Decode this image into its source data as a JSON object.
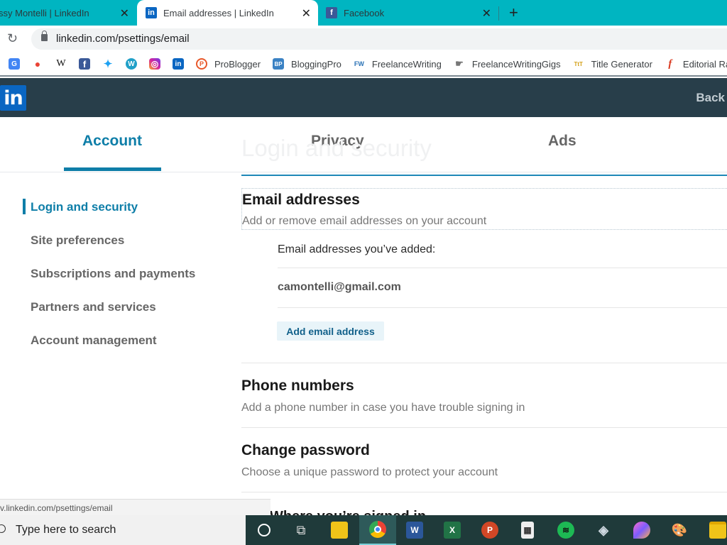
{
  "browser": {
    "tabs": [
      {
        "title": "ssy Montelli | LinkedIn",
        "active": false
      },
      {
        "title": "Email addresses | LinkedIn",
        "active": true
      },
      {
        "title": "Facebook",
        "active": false
      }
    ],
    "new_tab_label": "+",
    "close_glyph": "✕",
    "reload_glyph": "↻",
    "url": "linkedin.com/psettings/email",
    "bookmarks": [
      {
        "icon": "google-translate-icon",
        "label": "",
        "glyph": "G",
        "color": "#4285f4"
      },
      {
        "icon": "google-maps-icon",
        "label": "",
        "glyph": "●",
        "color": "#34a853"
      },
      {
        "icon": "wikipedia-icon",
        "label": "",
        "glyph": "W",
        "color": "#ffffff"
      },
      {
        "icon": "facebook-icon",
        "label": "",
        "glyph": "f",
        "color": "#3b5998"
      },
      {
        "icon": "twitter-icon",
        "label": "",
        "glyph": "t",
        "color": "#1da1f2"
      },
      {
        "icon": "wordpress-icon",
        "label": "",
        "glyph": "W",
        "color": "#21a0c8"
      },
      {
        "icon": "instagram-icon",
        "label": "",
        "glyph": "◎",
        "color": "#d6249f"
      },
      {
        "icon": "linkedin-icon",
        "label": "",
        "glyph": "in",
        "color": "#0a66c2"
      },
      {
        "icon": "problogger-icon",
        "label": "ProBlogger",
        "glyph": "P",
        "color": "#e8582a"
      },
      {
        "icon": "bloggingpro-icon",
        "label": "BloggingPro",
        "glyph": "BP",
        "color": "#3b82c4"
      },
      {
        "icon": "freelancewriting-icon",
        "label": "FreelanceWriting",
        "glyph": "FW",
        "color": "#ffffff"
      },
      {
        "icon": "freelancewritinggigs-icon",
        "label": "FreelanceWritingGigs",
        "glyph": "☛",
        "color": "#ffffff"
      },
      {
        "icon": "title-generator-icon",
        "label": "Title Generator",
        "glyph": "TtT",
        "color": "#ffffff"
      },
      {
        "icon": "editorial-icon",
        "label": "Editorial Ra",
        "glyph": "f",
        "color": "#ffffff"
      }
    ],
    "status_url": "v.linkedin.com/psettings/email"
  },
  "linkedin": {
    "logo": "in",
    "back_label": "Back",
    "nav_tabs": [
      {
        "label": "Account",
        "active": true
      },
      {
        "label": "Privacy",
        "active": false
      },
      {
        "label": "Ads",
        "active": false
      }
    ],
    "ghost_title": "Login and security",
    "sidebar": [
      {
        "label": "Login and security",
        "active": true
      },
      {
        "label": "Site preferences",
        "active": false
      },
      {
        "label": "Subscriptions and payments",
        "active": false
      },
      {
        "label": "Partners and services",
        "active": false
      },
      {
        "label": "Account management",
        "active": false
      }
    ],
    "email_section": {
      "title": "Email addresses",
      "subtitle": "Add or remove email addresses on your account",
      "added_label": "Email addresses you’ve added:",
      "emails": [
        "camontelli@gmail.com"
      ],
      "add_button": "Add email address"
    },
    "phone_section": {
      "title": "Phone numbers",
      "subtitle": "Add a phone number in case you have trouble signing in"
    },
    "password_section": {
      "title": "Change password",
      "subtitle": "Choose a unique password to protect your account"
    },
    "cutoff_section_title": "Where you’re signed in"
  },
  "taskbar": {
    "search_placeholder": "Type here to search",
    "apps": [
      {
        "name": "cortana-icon",
        "glyph": "○"
      },
      {
        "name": "task-view-icon",
        "glyph": "⧉"
      },
      {
        "name": "file-explorer-icon",
        "glyph": "▤"
      },
      {
        "name": "chrome-icon",
        "glyph": "◉"
      },
      {
        "name": "word-icon",
        "glyph": "W"
      },
      {
        "name": "excel-icon",
        "glyph": "X"
      },
      {
        "name": "powerpoint-icon",
        "glyph": "P"
      },
      {
        "name": "calculator-icon",
        "glyph": "▦"
      },
      {
        "name": "spotify-icon",
        "glyph": "≋"
      },
      {
        "name": "3d-viewer-icon",
        "glyph": "◈"
      },
      {
        "name": "paint-3d-icon",
        "glyph": "◆"
      },
      {
        "name": "paint-icon",
        "glyph": "🎨"
      },
      {
        "name": "folder-icon",
        "glyph": "▭"
      }
    ]
  }
}
